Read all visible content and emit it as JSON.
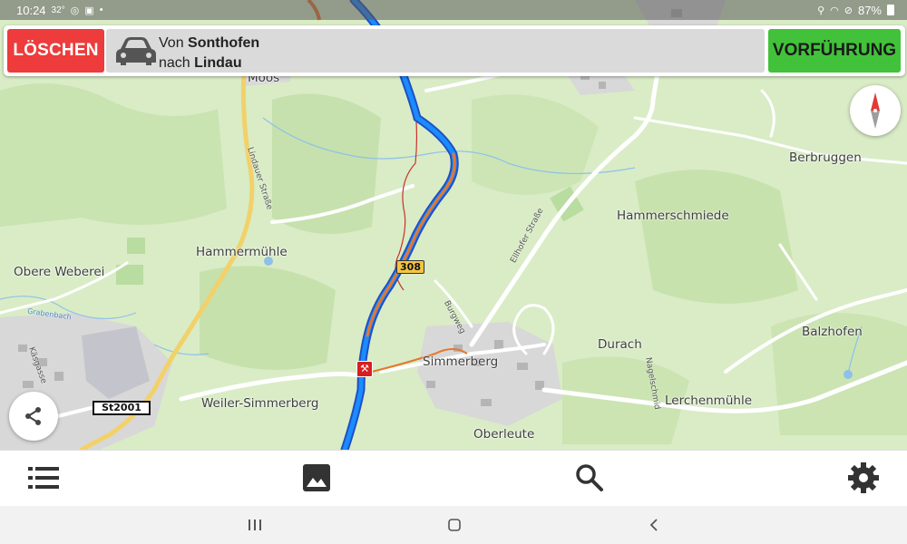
{
  "status_bar": {
    "time": "10:24",
    "temperature": "32°",
    "battery": "87%"
  },
  "route_bar": {
    "delete_label": "LÖSCHEN",
    "from_prefix": "Von",
    "from_place": "Sonthofen",
    "to_prefix": "nach",
    "to_place": "Lindau",
    "demo_label": "VORFÜHRUNG"
  },
  "map": {
    "places": {
      "moos": "Moos",
      "berbruggen": "Berbruggen",
      "hammerschmiede": "Hammerschmiede",
      "hammermuehle": "Hammermühle",
      "obere_weberei": "Obere Weberei",
      "durach": "Durach",
      "balzhofen": "Balzhofen",
      "simmerberg": "Simmerberg",
      "weiler_simmerberg": "Weiler-Simmerberg",
      "lerchenmuehle": "Lerchenmühle",
      "oberleute": "Oberleute"
    },
    "streets": {
      "lindauer_strasse": "Lindauer Straße",
      "ellhofer_strasse": "Ellhofer Straße",
      "burgweg": "Burgweg",
      "graben_bach": "Grabenbach",
      "kaeschgasse": "Käsgasse",
      "nagelschmidstrasse": "Nagelschmid"
    },
    "road_shields": {
      "b308": "308",
      "st2001": "St2001"
    }
  },
  "colors": {
    "delete": "#ee3b3b",
    "demo": "#42c23a",
    "route": "#1a73e8",
    "traffic": "#e8762a"
  },
  "icons": {
    "car": "car-icon",
    "compass": "compass-icon",
    "share": "share-icon",
    "menu": "list-icon",
    "image": "image-icon",
    "search": "search-icon",
    "settings": "gear-icon"
  }
}
